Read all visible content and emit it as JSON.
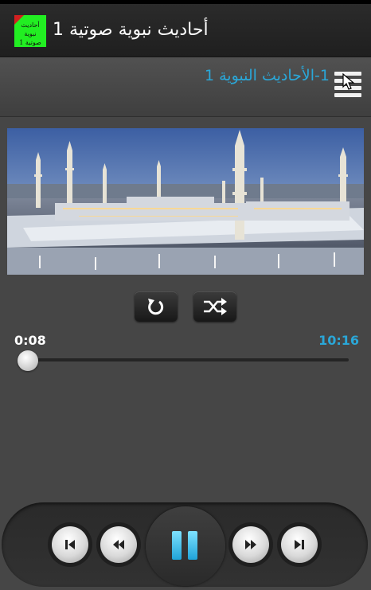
{
  "app": {
    "title": "أحاديث نبوية صوتية 1",
    "icon_text": "أحاديث نبوية صوتية 1",
    "icon": "app-logo-icon"
  },
  "track": {
    "title": "1-الأحاديث النبوية 1"
  },
  "header": {
    "menu_icon": "menu-icon"
  },
  "artwork": {
    "icon": "mosque-image"
  },
  "controls": {
    "repeat_icon": "repeat-icon",
    "shuffle_icon": "shuffle-icon"
  },
  "progress": {
    "elapsed": "0:08",
    "duration": "10:16",
    "fraction": 0.013
  },
  "player": {
    "previous_icon": "skip-previous-icon",
    "rewind_icon": "rewind-icon",
    "pause_icon": "pause-icon",
    "forward_icon": "fast-forward-icon",
    "next_icon": "skip-next-icon"
  },
  "colors": {
    "accent": "#2aa7d8",
    "background": "#464646",
    "action_bar": "#232323",
    "icon_green": "#22ee22"
  }
}
